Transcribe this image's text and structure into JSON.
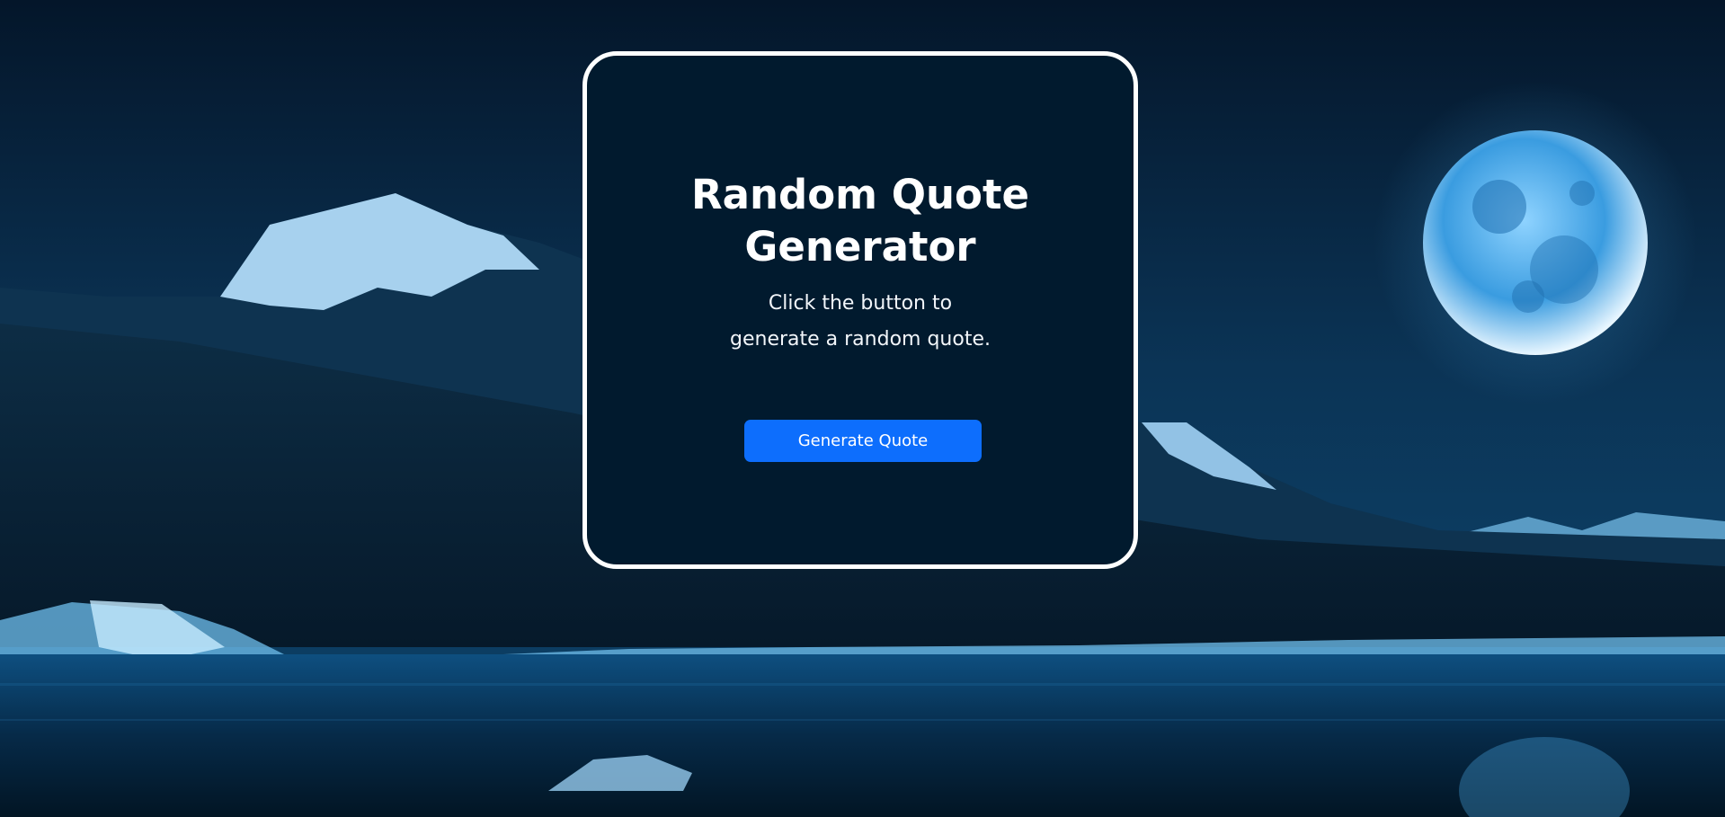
{
  "card": {
    "title": "Random Quote Generator",
    "subtitle": "Click the button to generate a random quote.",
    "button_label": "Generate Quote"
  },
  "colors": {
    "accent": "#0d6efd",
    "card_background": "#011a2e",
    "card_border": "#ffffff",
    "page_background": "#0a2740"
  },
  "background": {
    "icons": [
      "mountain-landscape",
      "moon-icon",
      "lake-reflection"
    ]
  }
}
